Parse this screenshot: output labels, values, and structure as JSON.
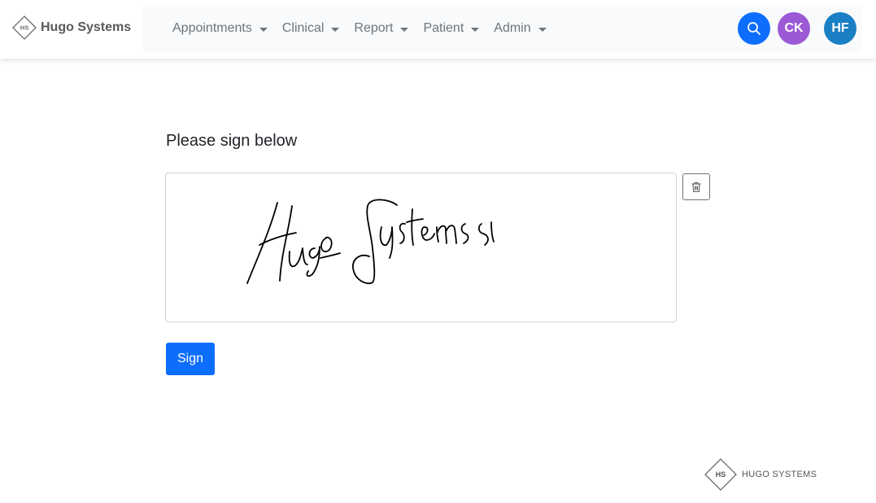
{
  "brand": {
    "logo_initials": "HS",
    "name": "Hugo Systems",
    "icon": "hs-diamond-logo"
  },
  "menu": {
    "items": [
      {
        "label": "Appointments"
      },
      {
        "label": "Clinical"
      },
      {
        "label": "Report"
      },
      {
        "label": "Patient"
      },
      {
        "label": "Admin"
      }
    ]
  },
  "header_actions": {
    "search_icon": "search-icon",
    "user1_initials": "CK",
    "user2_initials": "HF"
  },
  "signature": {
    "title": "Please sign below",
    "signed_text": "Hugo Systems",
    "clear_icon": "trash-icon",
    "sign_button_label": "Sign"
  },
  "footer": {
    "logo_initials": "HS",
    "brand_text": "HUGO SYSTEMS"
  },
  "colors": {
    "primary": "#0d6efd",
    "user1_bg": "#9b59d6",
    "user2_bg": "#1a7fc4",
    "menu_text": "#6c757d"
  }
}
